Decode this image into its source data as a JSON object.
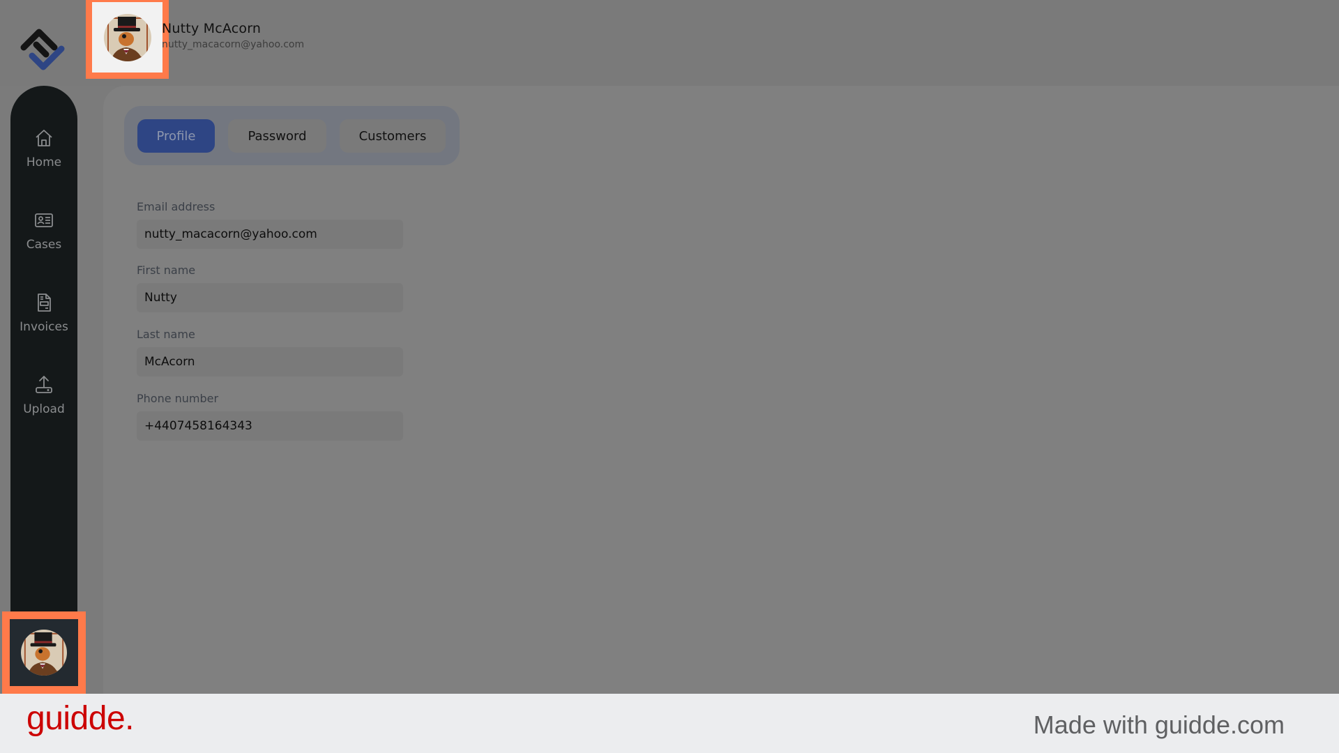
{
  "header": {
    "user_name": "Nutty McAcorn",
    "user_email": "nutty_macacorn@yahoo.com"
  },
  "sidebar": {
    "items": [
      {
        "label": "Home",
        "icon": "home-icon"
      },
      {
        "label": "Cases",
        "icon": "id-card-icon"
      },
      {
        "label": "Invoices",
        "icon": "invoice-icon"
      },
      {
        "label": "Upload",
        "icon": "upload-icon"
      }
    ]
  },
  "tabs": [
    {
      "label": "Profile",
      "active": true
    },
    {
      "label": "Password",
      "active": false
    },
    {
      "label": "Customers",
      "active": false
    }
  ],
  "form": {
    "fields": [
      {
        "label": "Email address",
        "value": "nutty_macacorn@yahoo.com"
      },
      {
        "label": "First name",
        "value": "Nutty"
      },
      {
        "label": "Last name",
        "value": "McAcorn"
      },
      {
        "label": "Phone number",
        "value": "+4407458164343"
      }
    ]
  },
  "colors": {
    "accent": "#2e4584",
    "highlight": "#ff7a4a",
    "brand_red": "#cc0000"
  },
  "footer": {
    "brand": "guidde.",
    "made_with": "Made with guidde.com"
  }
}
